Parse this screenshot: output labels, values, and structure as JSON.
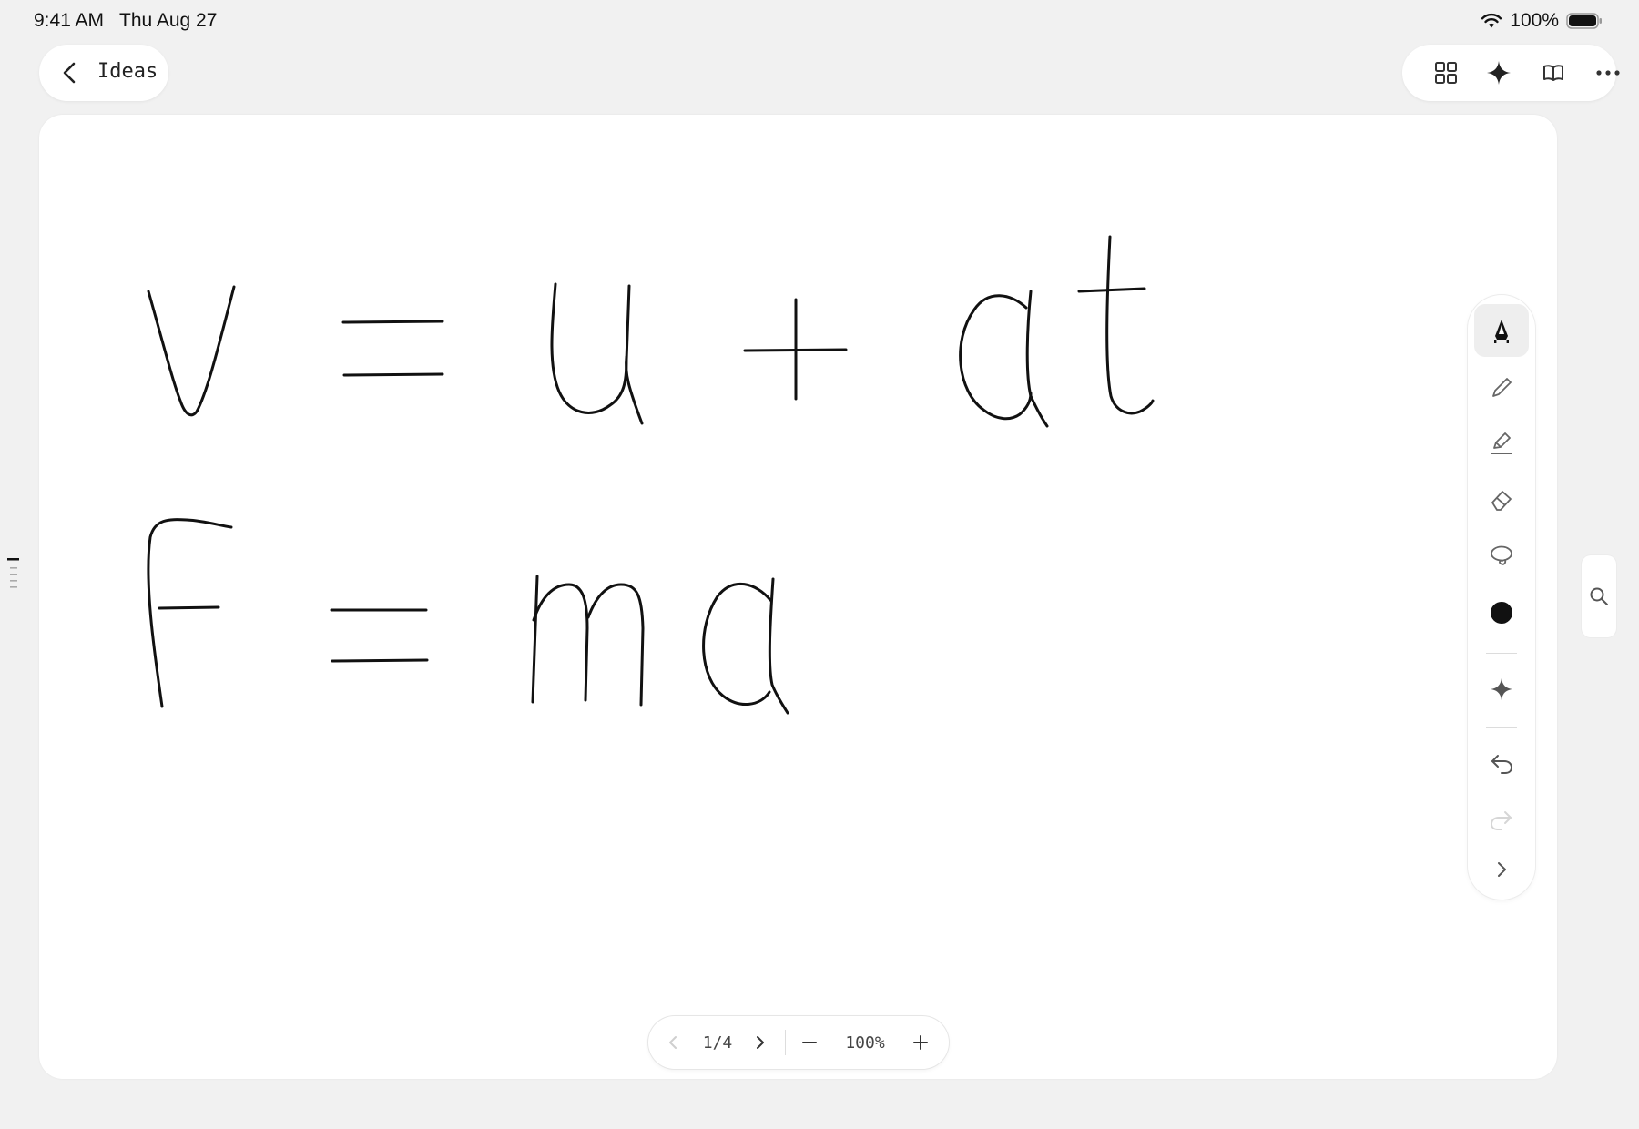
{
  "status_bar": {
    "time": "9:41 AM",
    "date": "Thu Aug 27",
    "battery_percent": "100%",
    "wifi_icon": "wifi-icon",
    "battery_icon": "battery-icon"
  },
  "header": {
    "back_icon": "chevron-left-icon",
    "title": "Ideas",
    "actions": [
      {
        "name": "grid-view",
        "icon": "grid-icon"
      },
      {
        "name": "ai-assist",
        "icon": "sparkle-icon"
      },
      {
        "name": "read-mode",
        "icon": "book-icon"
      },
      {
        "name": "more",
        "icon": "more-horizontal-icon"
      }
    ]
  },
  "canvas": {
    "ink_color": "#111111",
    "background": "#ffffff"
  },
  "tool_palette": {
    "selected_tool": "fountain-pen",
    "tools": [
      {
        "name": "fountain-pen",
        "icon": "fountain-pen-icon"
      },
      {
        "name": "pencil",
        "icon": "pencil-icon"
      },
      {
        "name": "highlighter",
        "icon": "highlighter-icon"
      },
      {
        "name": "eraser",
        "icon": "eraser-icon"
      },
      {
        "name": "lasso",
        "icon": "lasso-icon"
      },
      {
        "name": "color",
        "icon": "color-swatch-icon",
        "color": "#111111"
      },
      {
        "name": "ai-assist",
        "icon": "sparkle-icon"
      },
      {
        "name": "undo",
        "icon": "undo-icon"
      },
      {
        "name": "redo",
        "icon": "redo-icon",
        "enabled": false
      },
      {
        "name": "expand",
        "icon": "chevron-right-icon"
      }
    ]
  },
  "search": {
    "icon": "search-icon"
  },
  "pager": {
    "page_label": "1/4",
    "zoom_label": "100%",
    "prev_icon": "chevron-left-icon",
    "next_icon": "chevron-right-icon",
    "zoom_out_icon": "minus-icon",
    "zoom_in_icon": "plus-icon"
  }
}
